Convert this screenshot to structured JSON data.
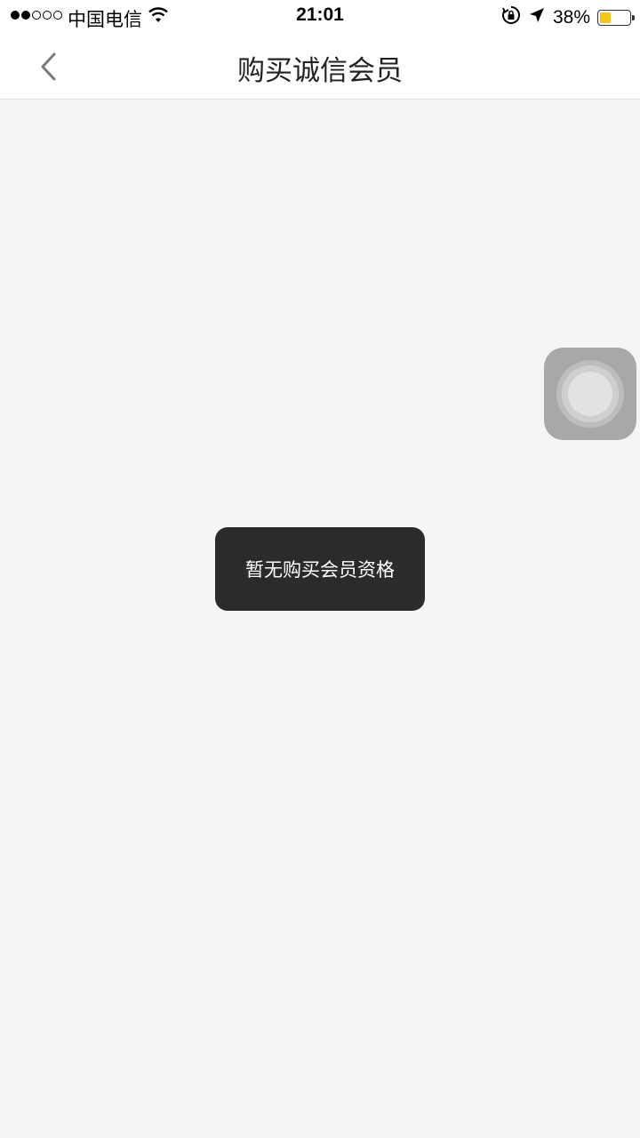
{
  "status_bar": {
    "carrier": "中国电信",
    "time": "21:01",
    "battery_percent": "38%",
    "battery_level": 0.38,
    "signal_bars_filled": 2,
    "signal_bars_total": 5,
    "icons": [
      "wifi-icon",
      "rotation-lock-icon",
      "location-arrow-icon",
      "battery-icon"
    ]
  },
  "nav": {
    "title": "购买诚信会员",
    "back_icon": "chevron-left-icon"
  },
  "toast": {
    "message": "暂无购买会员资格"
  },
  "colors": {
    "background": "#f5f5f5",
    "toast_bg": "#2b2b2b",
    "battery_fill": "#f5c518"
  }
}
